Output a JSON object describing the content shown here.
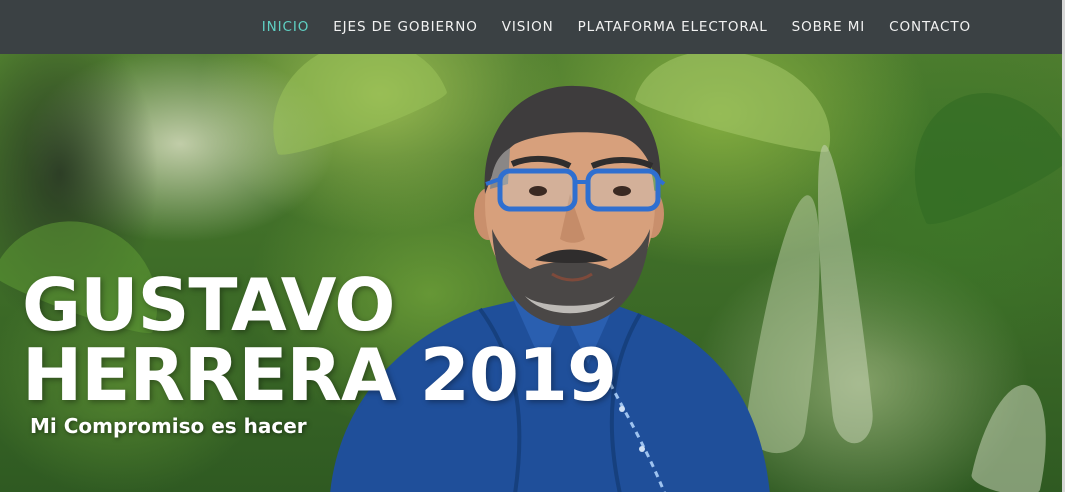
{
  "nav": {
    "items": [
      {
        "label": "INICIO",
        "active": true
      },
      {
        "label": "EJES DE GOBIERNO",
        "active": false
      },
      {
        "label": "VISION",
        "active": false
      },
      {
        "label": "PLATAFORMA ELECTORAL",
        "active": false
      },
      {
        "label": "SOBRE MI",
        "active": false
      },
      {
        "label": "CONTACTO",
        "active": false
      }
    ]
  },
  "hero": {
    "title_line1": "GUSTAVO",
    "title_line2": "HERRERA 2019",
    "subtitle": "Mi Compromiso es hacer"
  },
  "colors": {
    "navbar_bg": "#3b4144",
    "nav_text": "#f2f2f2",
    "nav_active": "#5fd1c4",
    "shirt": "#1f4f9a"
  }
}
